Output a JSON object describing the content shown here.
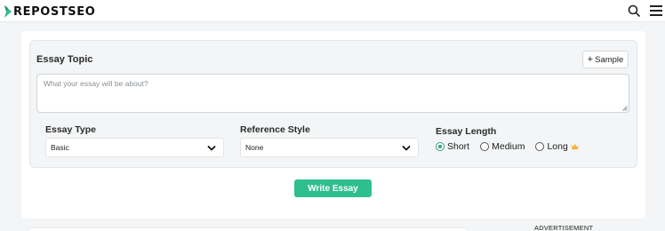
{
  "brand": {
    "name": "REPOSTSEO",
    "accent": "#2fbf8e"
  },
  "header": {
    "search_icon": "search-icon",
    "menu_icon": "hamburger-menu-icon"
  },
  "form": {
    "topic_label": "Essay Topic",
    "sample_button": "Sample",
    "topic_placeholder": "What your essay will be about?",
    "essay_type": {
      "label": "Essay Type",
      "selected": "Basic"
    },
    "reference_style": {
      "label": "Reference Style",
      "selected": "None"
    },
    "essay_length": {
      "label": "Essay Length",
      "options": [
        "Short",
        "Medium",
        "Long"
      ],
      "selected": "Short",
      "premium_option": "Long"
    },
    "submit_label": "Write Essay"
  },
  "ad_label": "ADVERTISEMENT"
}
